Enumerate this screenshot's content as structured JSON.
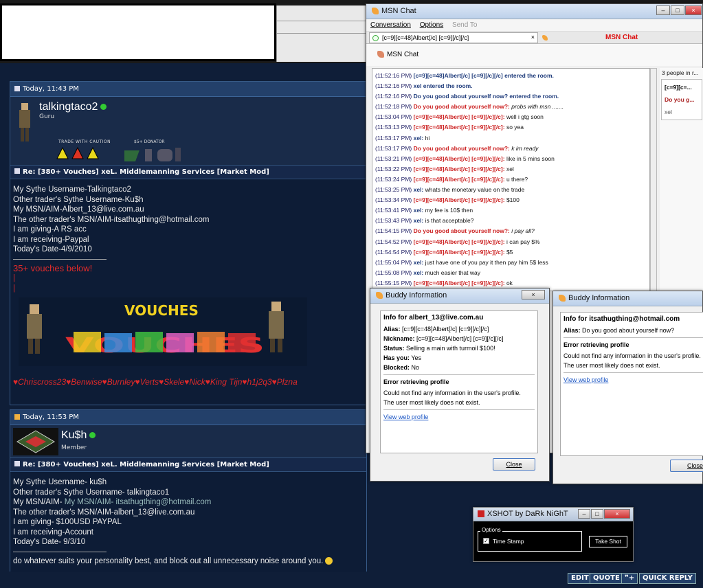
{
  "forum": {
    "post1": {
      "timestamp": "Today, 11:43 PM",
      "username": "talkingtaco2",
      "rank": "Guru",
      "badges_left": "TRADE WITH CAUTION",
      "badges_right": "$5+ DONATOR",
      "title": "Re: [380+ Vouches] xeL. Middlemanning Services [Market Mod]",
      "lines": [
        "My Sythe Username-Talkingtaco2",
        "Other trader's Sythe Username-Ku$h",
        "My MSN/AIM-Albert_13@live.com.au",
        "The other trader's MSN/AIM-itsathugthing@hotmail.com",
        "I am giving-A RS acc",
        "I am receiving-Paypal",
        "Today's Date-4/9/2010"
      ],
      "vouches_label": "35+ vouches below!",
      "bar1": "|",
      "bar2": "|",
      "banner_word": "VOUCHES",
      "vouch_names": "♥Chriscross23♥Benwise♥Burnley♥Verts♥Skele♥Nick♥King Tijn♥h1j2q3♥Plzna"
    },
    "post2": {
      "timestamp": "Today, 11:53 PM",
      "username": "Ku$h",
      "rank": "Member",
      "title": "Re: [380+ Vouches] xeL. Middlemanning Services [Market Mod]",
      "lines": [
        "My Sythe Username- ku$h",
        "Other trader's Sythe Username- talkingtaco1",
        "My MSN/AIM- itsathugthing@hotmail.com",
        "The other trader's MSN/AIM-albert_13@live.com.au",
        "I am giving- $100USD PAYPAL",
        "I am receiving-Account",
        "Today's Date- 9/3/10"
      ],
      "signature": "do whatever suits your personality best, and block out all unnecessary noise around you."
    },
    "buttons": {
      "edit": "EDIT",
      "quote": "QUOTE",
      "multi": "❞+",
      "quick_reply": "QUICK REPLY"
    }
  },
  "msn": {
    "title": "MSN Chat",
    "menu": {
      "conversation": "Conversation",
      "options": "Options",
      "send_to": "Send To"
    },
    "tab1": "[c=9][c=48]Albert[/c] [c=9][/c][/c]",
    "tab1_close": "×",
    "tab2": "MSN Chat",
    "conv_title": "MSN Chat",
    "people_header": "3 people in r...",
    "people": [
      "[c=9][c=...",
      "Do you g...",
      "xel"
    ],
    "log": [
      {
        "ts": "(11:52:16 PM)",
        "name": "[c=9][c=48]Albert[/c] [c=9][/c][/c] entered the room.",
        "cls": "nm-dark",
        "text": "",
        "tcls": "txt"
      },
      {
        "ts": "(11:52:16 PM)",
        "name": "xel entered the room.",
        "cls": "nm-dark",
        "text": "",
        "tcls": "txt"
      },
      {
        "ts": "(11:52:16 PM)",
        "name": "Do you good about yourself now? entered the room.",
        "cls": "nm-dark",
        "text": "",
        "tcls": "txt"
      },
      {
        "ts": "(11:52:18 PM)",
        "name": "Do you good about yourself now?:",
        "cls": "nm-red",
        "text": " probs with msn .......",
        "tcls": "txt-i"
      },
      {
        "ts": "(11:53:04 PM)",
        "name": "[c=9][c=48]Albert[/c] [c=9][/c][/c]:",
        "cls": "nm-red",
        "text": " well i gtg soon",
        "tcls": "txt"
      },
      {
        "ts": "(11:53:13 PM)",
        "name": "[c=9][c=48]Albert[/c] [c=9][/c][/c]:",
        "cls": "nm-red",
        "text": " so yea",
        "tcls": "txt"
      },
      {
        "ts": "(11:53:17 PM)",
        "name": "xel:",
        "cls": "nm-blue",
        "text": " hi",
        "tcls": "txt"
      },
      {
        "ts": "(11:53:17 PM)",
        "name": "Do you good about yourself now?:",
        "cls": "nm-red",
        "text": " k im ready",
        "tcls": "txt-i"
      },
      {
        "ts": "(11:53:21 PM)",
        "name": "[c=9][c=48]Albert[/c] [c=9][/c][/c]:",
        "cls": "nm-red",
        "text": " like in 5 mins soon",
        "tcls": "txt"
      },
      {
        "ts": "(11:53:22 PM)",
        "name": "[c=9][c=48]Albert[/c] [c=9][/c][/c]:",
        "cls": "nm-red",
        "text": " xel",
        "tcls": "txt"
      },
      {
        "ts": "(11:53:24 PM)",
        "name": "[c=9][c=48]Albert[/c] [c=9][/c][/c]:",
        "cls": "nm-red",
        "text": " u there?",
        "tcls": "txt"
      },
      {
        "ts": "(11:53:25 PM)",
        "name": "xel:",
        "cls": "nm-blue",
        "text": " whats the monetary value on the trade",
        "tcls": "txt"
      },
      {
        "ts": "(11:53:34 PM)",
        "name": "[c=9][c=48]Albert[/c] [c=9][/c][/c]:",
        "cls": "nm-red",
        "text": " $100",
        "tcls": "txt"
      },
      {
        "ts": "(11:53:41 PM)",
        "name": "xel:",
        "cls": "nm-blue",
        "text": " my fee is 10$ then",
        "tcls": "txt"
      },
      {
        "ts": "(11:53:43 PM)",
        "name": "xel:",
        "cls": "nm-blue",
        "text": " is that acceptable?",
        "tcls": "txt"
      },
      {
        "ts": "(11:54:15 PM)",
        "name": "Do you good about yourself now?:",
        "cls": "nm-red",
        "text": " i pay all?",
        "tcls": "txt-i"
      },
      {
        "ts": "(11:54:52 PM)",
        "name": "[c=9][c=48]Albert[/c] [c=9][/c][/c]:",
        "cls": "nm-red",
        "text": " i can pay $%",
        "tcls": "txt"
      },
      {
        "ts": "(11:54:54 PM)",
        "name": "[c=9][c=48]Albert[/c] [c=9][/c][/c]:",
        "cls": "nm-red",
        "text": " $5",
        "tcls": "txt"
      },
      {
        "ts": "(11:55:04 PM)",
        "name": "xel:",
        "cls": "nm-blue",
        "text": " just have one of you pay it then pay him 5$ less",
        "tcls": "txt"
      },
      {
        "ts": "(11:55:08 PM)",
        "name": "xel:",
        "cls": "nm-blue",
        "text": " much easier that way",
        "tcls": "txt"
      },
      {
        "ts": "(11:55:15 PM)",
        "name": "[c=9][c=48]Albert[/c] [c=9][/c][/c]:",
        "cls": "nm-red",
        "text": " ok",
        "tcls": "txt"
      }
    ]
  },
  "buddy1": {
    "title": "Buddy Information",
    "header": "Info for albert_13@live.com.au",
    "alias_label": "Alias:",
    "alias": " [c=9][c=48]Albert[/c] [c=9][/c][/c]",
    "nick_label": "Nickname:",
    "nick": " [c=9][c=48]Albert[/c] [c=9][/c][/c]",
    "status_label": "Status:",
    "status": " Selling a main with turmoil $100!",
    "has_label": "Has you:",
    "has": " Yes",
    "blocked_label": "Blocked:",
    "blocked": " No",
    "err_title": "Error retrieving profile",
    "err_1": "Could not find any information in the user's profile.",
    "err_2": "The user most likely does not exist.",
    "link": "View web profile",
    "close": "Close"
  },
  "buddy2": {
    "title": "Buddy Information",
    "header": "Info for itsathugthing@hotmail.com",
    "alias_label": "Alias:",
    "alias": " Do you good about yourself now?",
    "err_title": "Error retrieving profile",
    "err_1": "Could not find any information in the user's profile.",
    "err_2": "The user most likely does not exist.",
    "link": "View web profile",
    "close": "Close"
  },
  "xshot": {
    "title": "XSHOT by DaRk NiGhT",
    "legend": "Options",
    "check_mark": "✓",
    "checkbox_label": "Time Stamp",
    "button": "Take Shot"
  },
  "colors": {
    "forum_bg": "#0f1e38",
    "vouch_red": "#e02a2a",
    "msn_red": "#c22",
    "link": "#1a55c4"
  }
}
